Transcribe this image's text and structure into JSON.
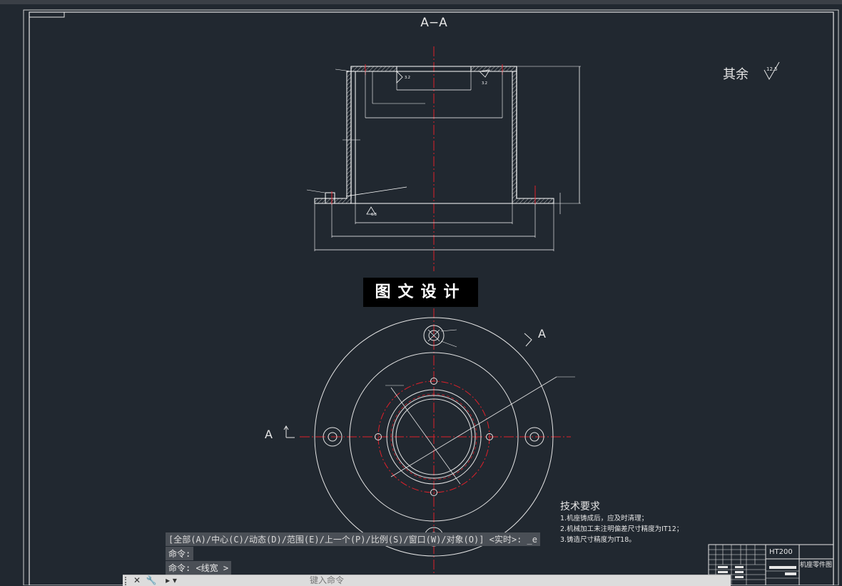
{
  "drawing": {
    "section_title": "A−A",
    "section_mark": "A",
    "surface_rest_label": "其余",
    "surface_rest_value": "12.5",
    "roughness_values": [
      "3.2",
      "3.2",
      "6.3"
    ],
    "tech_requirements": {
      "title": "技术要求",
      "items": [
        "1.机座铸成后，应及时清理；",
        "2.机械加工未注明偏差尺寸精度为IT12；",
        "3.铸造尺寸精度为IT18。"
      ]
    },
    "title_block": {
      "material": "HT200",
      "part_name": "机座零件图"
    },
    "watermark": "图文设计"
  },
  "command": {
    "history": "[全部(A)/中心(C)/动态(D)/范围(E)/上一个(P)/比例(S)/窗口(W)/对象(O)] <实时>: _e",
    "prev": "命令:",
    "last": "命令: <线宽 >",
    "placeholder": "键入命令"
  },
  "colors": {
    "background": "#212830",
    "line": "#ffffff",
    "centerline": "#e0202a"
  }
}
